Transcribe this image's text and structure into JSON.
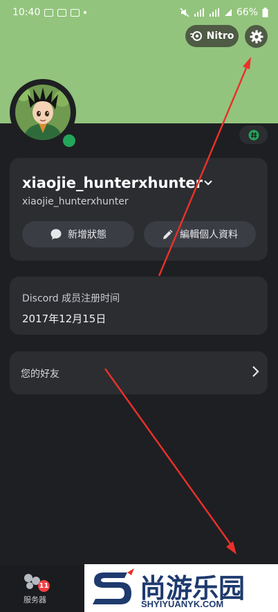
{
  "status_bar": {
    "time": "10:40",
    "battery": "66%"
  },
  "header": {
    "nitro_label": "Nitro",
    "nitro_icon": "nitro-icon",
    "settings_icon": "gear-icon"
  },
  "colors": {
    "banner": "#93c47d",
    "background": "#1e1f22",
    "card": "#2b2d31",
    "online": "#23a55a",
    "badge": "#f23f43",
    "arrow": "#e8312a"
  },
  "profile": {
    "display_name": "xiaojie_hunterxhunter",
    "username": "xiaojie_hunterxhunter",
    "status_button": "新增狀態",
    "edit_button": "編輯個人資料"
  },
  "member": {
    "label": "Discord 成员注册时间",
    "date": "2017年12月15日"
  },
  "friends": {
    "label": "您的好友"
  },
  "bottom_nav": {
    "servers_label": "服务器",
    "servers_badge": "11"
  },
  "watermark": {
    "cn": "尚游乐园",
    "en": "SHYIYUANYK.COM"
  }
}
